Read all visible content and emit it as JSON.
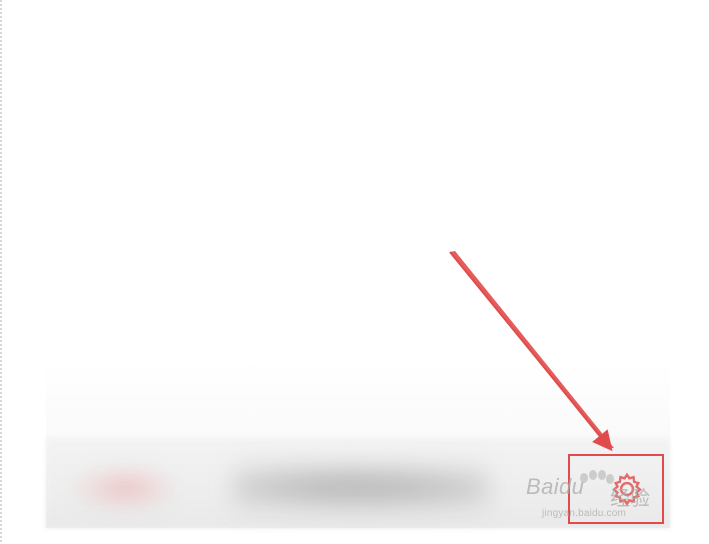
{
  "watermark": {
    "brand": "Bai",
    "brand_suffix": "du",
    "service": "经验",
    "url": "jingyan.baidu.com"
  },
  "colors": {
    "annotation": "#e14b4b",
    "blurred_red": "#e65a5a",
    "background": "#ffffff",
    "bar": "#efefef"
  },
  "icons": {
    "target": "gear-icon",
    "pointer": "arrow-icon",
    "watermark_mark": "paw-icon"
  }
}
